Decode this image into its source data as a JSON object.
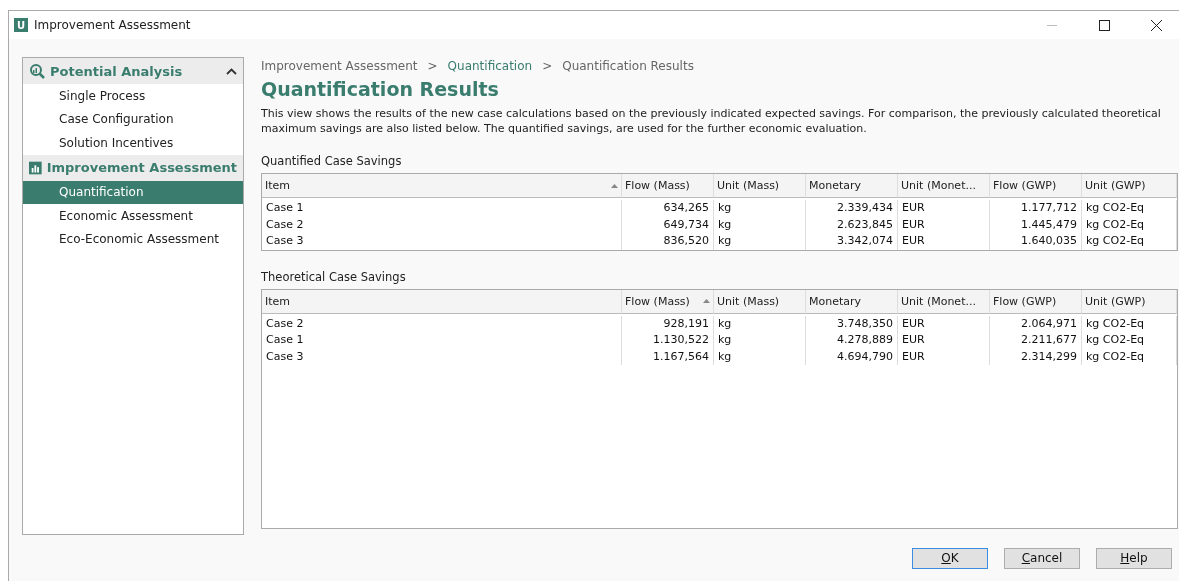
{
  "window": {
    "title": "Improvement Assessment",
    "app_letter": "U"
  },
  "sidebar": {
    "groups": [
      {
        "kind": "analysis",
        "title": "Potential Analysis",
        "items": [
          {
            "label": "Single Process",
            "selected": false
          },
          {
            "label": "Case Configuration",
            "selected": false
          },
          {
            "label": "Solution Incentives",
            "selected": false
          }
        ]
      },
      {
        "kind": "assessment",
        "title": "Improvement Assessment",
        "items": [
          {
            "label": "Quantification",
            "selected": true
          },
          {
            "label": "Economic Assessment",
            "selected": false
          },
          {
            "label": "Eco-Economic Assessment",
            "selected": false
          }
        ]
      }
    ]
  },
  "breadcrumb": [
    {
      "label": "Improvement Assessment",
      "link": false
    },
    {
      "label": "Quantification",
      "link": true
    },
    {
      "label": "Quantification Results",
      "link": false
    }
  ],
  "breadcrumb_separator": ">",
  "heading": "Quantification Results",
  "description": "This view shows the results of the new case calculations based on the previously indicated expected savings. For comparison, the previously calculated theoretical maximum savings are also listed below. The quantified savings, are used for the further economic evaluation.",
  "tables": [
    {
      "title": "Quantified Case Savings",
      "columns": [
        {
          "label": "Item",
          "sorted": true,
          "kind": "text"
        },
        {
          "label": "Flow (Mass)",
          "sorted": false,
          "kind": "number"
        },
        {
          "label": "Unit (Mass)",
          "sorted": false,
          "kind": "text"
        },
        {
          "label": "Monetary",
          "sorted": false,
          "kind": "number"
        },
        {
          "label": "Unit (Monet...",
          "sorted": false,
          "kind": "text"
        },
        {
          "label": "Flow (GWP)",
          "sorted": false,
          "kind": "number"
        },
        {
          "label": "Unit (GWP)",
          "sorted": false,
          "kind": "text"
        }
      ],
      "rows": [
        [
          "Case 1",
          "634,265",
          "kg",
          "2.339,434",
          "EUR",
          "1.177,712",
          "kg CO2-Eq"
        ],
        [
          "Case 2",
          "649,734",
          "kg",
          "2.623,845",
          "EUR",
          "1.445,479",
          "kg CO2-Eq"
        ],
        [
          "Case 3",
          "836,520",
          "kg",
          "3.342,074",
          "EUR",
          "1.640,035",
          "kg CO2-Eq"
        ]
      ]
    },
    {
      "title": "Theoretical Case Savings",
      "columns": [
        {
          "label": "Item",
          "sorted": false,
          "kind": "text"
        },
        {
          "label": "Flow (Mass)",
          "sorted": true,
          "kind": "number"
        },
        {
          "label": "Unit (Mass)",
          "sorted": false,
          "kind": "text"
        },
        {
          "label": "Monetary",
          "sorted": false,
          "kind": "number"
        },
        {
          "label": "Unit (Monet...",
          "sorted": false,
          "kind": "text"
        },
        {
          "label": "Flow (GWP)",
          "sorted": false,
          "kind": "number"
        },
        {
          "label": "Unit (GWP)",
          "sorted": false,
          "kind": "text"
        }
      ],
      "rows": [
        [
          "Case 2",
          "928,191",
          "kg",
          "3.748,350",
          "EUR",
          "2.064,971",
          "kg CO2-Eq"
        ],
        [
          "Case 1",
          "1.130,522",
          "kg",
          "4.278,889",
          "EUR",
          "2.211,677",
          "kg CO2-Eq"
        ],
        [
          "Case 3",
          "1.167,564",
          "kg",
          "4.694,790",
          "EUR",
          "2.314,299",
          "kg CO2-Eq"
        ]
      ]
    }
  ],
  "buttons": [
    {
      "access_key": "O",
      "rest": "K",
      "default": true
    },
    {
      "access_key": "C",
      "rest": "ancel",
      "default": false
    },
    {
      "access_key": "H",
      "rest": "elp",
      "default": false
    }
  ]
}
